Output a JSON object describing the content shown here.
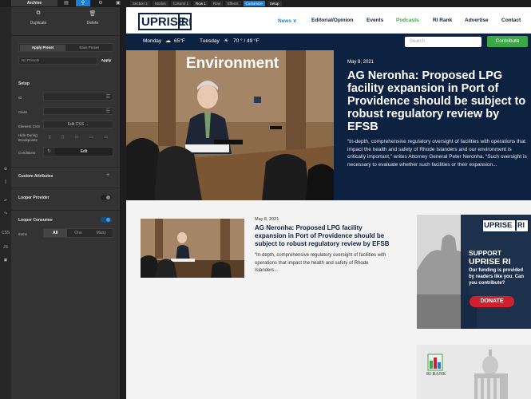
{
  "toolbar": {
    "archive_label": "Archive",
    "breadcrumbs": [
      "Section 1",
      "Stories",
      "Column 1",
      "Row 1",
      "Row",
      "Effects",
      "Customize",
      "Setup"
    ]
  },
  "panel": {
    "duplicate_label": "Duplicate",
    "delete_label": "Delete",
    "tab_apply_preset": "Apply Preset",
    "tab_save_preset": "Save Preset",
    "no_presets": "No Presets",
    "apply_label": "Apply",
    "setup_heading": "Setup",
    "id_label": "ID",
    "class_label": "Class",
    "element_css_label": "Element CSS",
    "edit_css_label": "Edit CSS →",
    "hide_breakpoints_label": "Hide During Breakpoints",
    "conditions_label": "Conditions",
    "edit_label": "Edit",
    "custom_attributes_label": "Custom Attributes",
    "looper_provider_label": "Looper Provider",
    "looper_consumer_label": "Looper Consumer",
    "items_label": "Items",
    "items_options": [
      "All",
      "One",
      "Many"
    ],
    "rail_css": "CSS",
    "rail_js": "JS"
  },
  "site": {
    "logo_uprise": "UPRISE",
    "logo_ri": "RI",
    "nav": [
      "News ∨",
      "Editorial/Opinion",
      "Events",
      "Podcasts",
      "RI Rank",
      "Advertise",
      "Contact"
    ],
    "weather_day1": "Monday",
    "weather_temp1": "65°F",
    "weather_day2": "Tuesday",
    "weather_temp2": "70 ° / 49 °F",
    "search_placeholder": "Search",
    "contribute_label": "Contribute",
    "hero": {
      "category": "Environment",
      "date": "May 8, 2021",
      "title": "AG Neronha: Proposed LPG facility expansion in Port of Providence should be subject to robust regulatory review by EFSB",
      "excerpt": "“In-depth, comprehensive regulatory oversight of facilities with operations that impact the health and safety of Rhode Islanders and our environment is critically important,” writes Attorney General Peter Neronha. “Such oversight is necessary to evaluate whether such facilities or their expansion..."
    },
    "article": {
      "date": "May 8, 2021",
      "title": "AG Neronha: Proposed LPG facility expansion in Port of Providence should be subject to robust regulatory review by EFSB",
      "excerpt": "“In-depth, comprehensive regulatory oversight of facilities with operations that impact the health and safety of Rhode Islanders..."
    },
    "ad1": {
      "logo_uprise": "UPRISE",
      "logo_ri": "RI",
      "support": "SUPPORT",
      "brand": "UPRISE RI",
      "body": "Our funding is provided by readers like you. Can you contribute?",
      "donate": "DONATE"
    },
    "ad2": {
      "ri_rank": "RI RANK"
    }
  },
  "colors": {
    "navy": "#0d2240",
    "green": "#3aa845",
    "accent_blue": "#1c7fd6",
    "donate_red": "#d0202e"
  }
}
